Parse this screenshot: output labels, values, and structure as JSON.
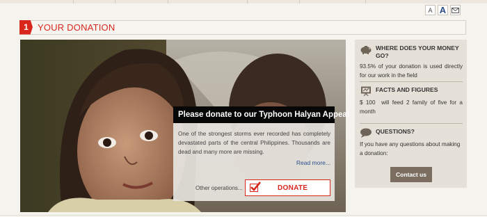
{
  "toolbar": {
    "font_small_label": "A",
    "font_large_label": "A",
    "email_icon": "envelope-icon"
  },
  "section": {
    "step_number": "1",
    "title": "YOUR DONATION"
  },
  "appeal": {
    "title": "Please donate to our Typhoon Halyan Appeal",
    "text": "One of the strongest storms ever recorded has completely devastated parts of the central Philippines. Thousands are dead and many more are missing.",
    "read_more": "Read more...",
    "other_operations": "Other operations...",
    "donate_label": "DONATE"
  },
  "sidebar": {
    "money": {
      "icon": "piggy-bank-icon",
      "title": "WHERE DOES YOUR MONEY GO?",
      "text": "93.5% of your donation is used directly for our work in the field"
    },
    "facts": {
      "icon": "presentation-icon",
      "title": "FACTS AND FIGURES",
      "text": "$ 100  will feed 2 family of five for a month"
    },
    "questions": {
      "icon": "speech-bubble-icon",
      "title": "QUESTIONS?",
      "text": "If you have any questions about making a donation:",
      "contact_label": "Contact us"
    }
  },
  "colors": {
    "accent_red": "#d8261d",
    "sidebar_bg": "#e5e1d8",
    "button_brown": "#7b6e60",
    "link_blue": "#2d4e8c"
  }
}
